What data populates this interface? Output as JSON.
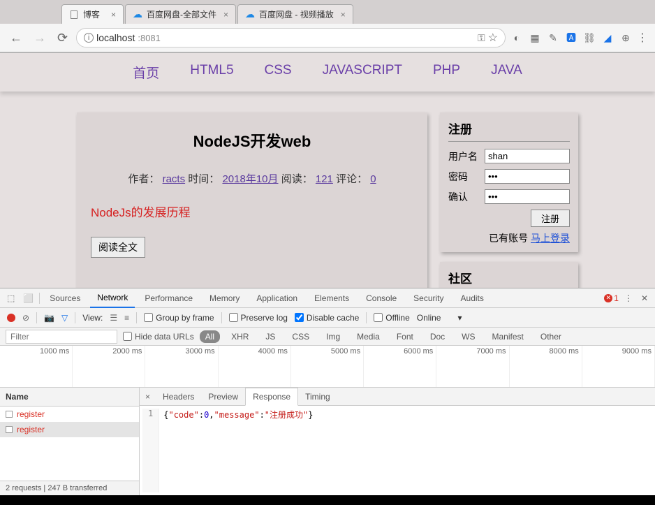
{
  "browser": {
    "tabs": [
      {
        "title": "博客",
        "active": true,
        "icon": "doc"
      },
      {
        "title": "百度网盘-全部文件",
        "active": false,
        "icon": "cloud"
      },
      {
        "title": "百度网盘 - 视频播放",
        "active": false,
        "icon": "cloud"
      }
    ],
    "url_host": "localhost",
    "url_port": ":8081"
  },
  "nav": {
    "items": [
      "首页",
      "HTML5",
      "CSS",
      "JAVASCRIPT",
      "PHP",
      "JAVA"
    ]
  },
  "article": {
    "title": "NodeJS开发web",
    "author_label": "作者：",
    "author": "racts",
    "time_label": "时间：",
    "time": "2018年10月",
    "read_label": "阅读：",
    "read_count": "121",
    "comment_label": "评论：",
    "comment_count": "0",
    "subtitle": "NodeJs的发展历程",
    "read_more": "阅读全文"
  },
  "register": {
    "title": "注册",
    "username_label": "用户名",
    "username_value": "shan",
    "password_label": "密码",
    "password_value": "•••",
    "confirm_label": "确认",
    "confirm_value": "•••",
    "submit": "注册",
    "has_account": "已有账号",
    "login_now": "马上登录"
  },
  "community": {
    "title": "社区"
  },
  "devtools": {
    "tabs": [
      "Sources",
      "Network",
      "Performance",
      "Memory",
      "Application",
      "Elements",
      "Console",
      "Security",
      "Audits"
    ],
    "active_tab": "Network",
    "error_count": "1",
    "toolbar": {
      "view_label": "View:",
      "group_by_frame": "Group by frame",
      "preserve_log": "Preserve log",
      "disable_cache": "Disable cache",
      "offline": "Offline",
      "online": "Online"
    },
    "filter": {
      "placeholder": "Filter",
      "hide_urls": "Hide data URLs",
      "types": [
        "All",
        "XHR",
        "JS",
        "CSS",
        "Img",
        "Media",
        "Font",
        "Doc",
        "WS",
        "Manifest",
        "Other"
      ],
      "active_type": "All"
    },
    "timeline_labels": [
      "1000 ms",
      "2000 ms",
      "3000 ms",
      "4000 ms",
      "5000 ms",
      "6000 ms",
      "7000 ms",
      "8000 ms",
      "9000 ms"
    ],
    "requests": {
      "header": "Name",
      "items": [
        "register",
        "register"
      ],
      "footer": "2 requests  |  247 B transferred"
    },
    "response": {
      "tabs": [
        "Headers",
        "Preview",
        "Response",
        "Timing"
      ],
      "active_tab": "Response",
      "line_no": "1",
      "body_raw": "{\"code\":0,\"message\":\"注册成功\"}",
      "code_key": "\"code\"",
      "code_val": "0",
      "msg_key": "\"message\"",
      "msg_val": "\"注册成功\""
    }
  }
}
